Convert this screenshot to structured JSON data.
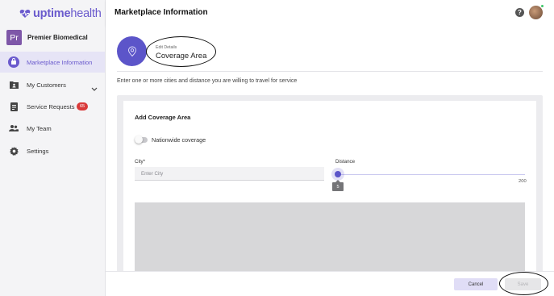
{
  "brand": {
    "name_bold": "uptime",
    "name_light": "health",
    "accent": "#6a5acd"
  },
  "organization": {
    "initials": "Pr",
    "name": "Premier Biomedical"
  },
  "sidebar": {
    "items": [
      {
        "label": "Marketplace Information",
        "icon": "shopping-bag-icon",
        "active": true
      },
      {
        "label": "My Customers",
        "icon": "customers-icon",
        "expandable": true
      },
      {
        "label": "Service Requests",
        "icon": "clipboard-icon",
        "badge": "65"
      },
      {
        "label": "My Team",
        "icon": "people-icon"
      },
      {
        "label": "Settings",
        "icon": "gear-icon"
      }
    ]
  },
  "header": {
    "title": "Marketplace Information",
    "help_icon": "help-icon",
    "avatar": "user-avatar"
  },
  "section": {
    "eyebrow": "Edit Details",
    "title": "Coverage Area",
    "icon": "location-pin-icon",
    "instructions": "Enter one or more cities and distance you are willing to travel for service"
  },
  "coverage_form": {
    "title": "Add Coverage Area",
    "nationwide_label": "Nationwide coverage",
    "nationwide_enabled": false,
    "city_label": "City*",
    "city_placeholder": "Enter City",
    "city_value": "",
    "distance_label": "Distance",
    "distance_value": "5",
    "distance_max": "200"
  },
  "footer": {
    "cancel_label": "Cancel",
    "save_label": "Save"
  },
  "colors": {
    "primary": "#5c55c9",
    "badge": "#d93a3a",
    "online": "#3ec76a"
  }
}
